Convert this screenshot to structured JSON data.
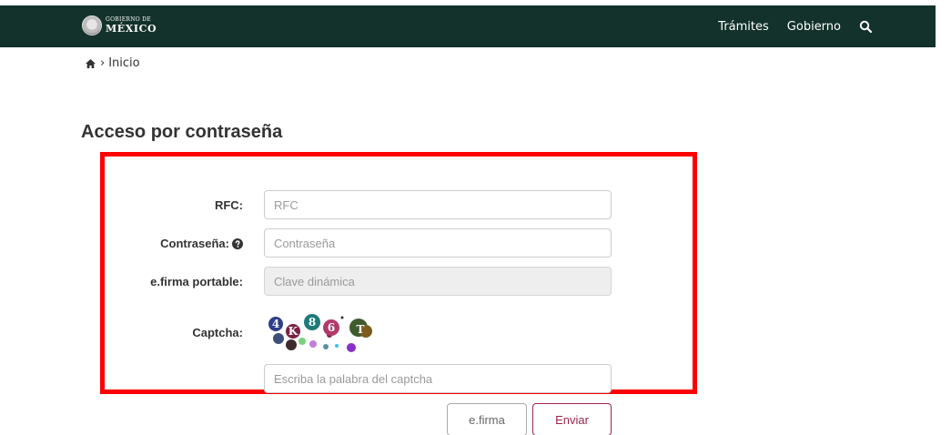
{
  "header": {
    "brand_small": "GOBIERNO DE",
    "brand_big": "MÉXICO",
    "nav": [
      "Trámites",
      "Gobierno"
    ],
    "colors": {
      "background": "#13322b",
      "text": "#ffffff"
    },
    "icons": {
      "seal": "government-seal-icon",
      "search": "search-icon"
    }
  },
  "breadcrumb": {
    "separator": "›",
    "label": "Inicio",
    "icons": {
      "home": "home-icon"
    }
  },
  "page": {
    "title": "Acceso por contraseña"
  },
  "form": {
    "rfc": {
      "label": "RFC:",
      "placeholder": "RFC",
      "value": ""
    },
    "password": {
      "label": "Contraseña:",
      "placeholder": "Contraseña",
      "value": "",
      "icon": "question-circle-icon"
    },
    "efirma_portable": {
      "label": "e.firma portable:",
      "placeholder": "Clave dinámica",
      "disabled": true
    },
    "captcha": {
      "label": "Captcha:",
      "glyphs": [
        "4",
        "K",
        "8",
        "6",
        "T"
      ],
      "input_placeholder": "Escriba la palabra del captcha"
    }
  },
  "buttons": {
    "efirma": "e.firma",
    "enviar": "Enviar",
    "colors": {
      "enviar_border": "#9d2449",
      "efirma_border": "#aaaaaa"
    }
  },
  "highlight": {
    "color": "#ff0000"
  }
}
